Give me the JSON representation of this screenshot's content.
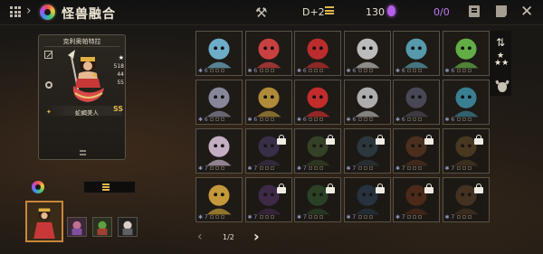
{
  "header": {
    "title": "怪兽融合",
    "difficulty": "D+2",
    "coins": "130",
    "counter": "0/0"
  },
  "selected": {
    "name": "克利奥帕特拉",
    "stats": [
      "518",
      "44",
      "55"
    ],
    "species": "蛇蝎美人",
    "grade": "SS"
  },
  "pagination": {
    "label": "1/2"
  },
  "grid": {
    "rows": [
      [
        {
          "n": "6",
          "locked": false,
          "c": "#7cc8e8"
        },
        {
          "n": "6",
          "locked": false,
          "c": "#e84848"
        },
        {
          "n": "6",
          "locked": false,
          "c": "#d83030"
        },
        {
          "n": "6",
          "locked": false,
          "c": "#d8d8d8"
        },
        {
          "n": "6",
          "locked": false,
          "c": "#60b0c8"
        },
        {
          "n": "6",
          "locked": false,
          "c": "#70c850"
        }
      ],
      [
        {
          "n": "6",
          "locked": false,
          "c": "#9a9ab0"
        },
        {
          "n": "6",
          "locked": false,
          "c": "#c8a040"
        },
        {
          "n": "6",
          "locked": false,
          "c": "#e03030"
        },
        {
          "n": "6",
          "locked": false,
          "c": "#c8c8c8"
        },
        {
          "n": "6",
          "locked": false,
          "c": "#505060"
        },
        {
          "n": "6",
          "locked": false,
          "c": "#4090a8"
        }
      ],
      [
        {
          "n": "7",
          "locked": false,
          "c": "#e0c8e0"
        },
        {
          "n": "7",
          "locked": true,
          "c": "#8060c0"
        },
        {
          "n": "7",
          "locked": true,
          "c": "#70a050"
        },
        {
          "n": "7",
          "locked": true,
          "c": "#5080a0"
        },
        {
          "n": "7",
          "locked": true,
          "c": "#c06030"
        },
        {
          "n": "7",
          "locked": true,
          "c": "#b08040"
        }
      ],
      [
        {
          "n": "7",
          "locked": false,
          "c": "#e0b040"
        },
        {
          "n": "7",
          "locked": true,
          "c": "#9050c0"
        },
        {
          "n": "7",
          "locked": true,
          "c": "#50a050"
        },
        {
          "n": "7",
          "locked": true,
          "c": "#4070a0"
        },
        {
          "n": "7",
          "locked": true,
          "c": "#c05020"
        },
        {
          "n": "7",
          "locked": true,
          "c": "#a07040"
        }
      ]
    ]
  },
  "colors": {
    "accent": "#e0b84a",
    "frame": "#5a5246",
    "purple": "#c37af0"
  }
}
